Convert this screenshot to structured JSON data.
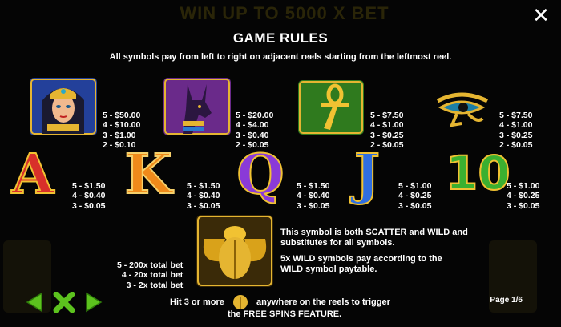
{
  "background": {
    "banner": "WIN UP TO 5000 X BET"
  },
  "header": {
    "title": "GAME RULES",
    "subtitle": "All symbols pay from left to right on adjacent reels starting from the leftmost reel."
  },
  "symbols_row1": [
    {
      "icon": "cleopatra-icon",
      "pays": [
        "5 - $50.00",
        "4 - $10.00",
        "3 - $1.00",
        "2 - $0.10"
      ]
    },
    {
      "icon": "anubis-icon",
      "pays": [
        "5 - $20.00",
        "4 - $4.00",
        "3 - $0.40",
        "2 - $0.05"
      ]
    },
    {
      "icon": "ankh-icon",
      "pays": [
        "5 - $7.50",
        "4 - $1.00",
        "3 - $0.25",
        "2 - $0.05"
      ]
    },
    {
      "icon": "eye-of-horus-icon",
      "pays": [
        "5 - $7.50",
        "4 - $1.00",
        "3 - $0.25",
        "2 - $0.05"
      ]
    }
  ],
  "symbols_row2": [
    {
      "letter": "A",
      "icon": "letter-a-icon",
      "color": "#d8302a",
      "pays": [
        "5 - $1.50",
        "4 - $0.40",
        "3 - $0.05"
      ]
    },
    {
      "letter": "K",
      "icon": "letter-k-icon",
      "color": "#f08a1a",
      "pays": [
        "5 - $1.50",
        "4 - $0.40",
        "3 - $0.05"
      ]
    },
    {
      "letter": "Q",
      "icon": "letter-q-icon",
      "color": "#8a3ad8",
      "pays": [
        "5 - $1.50",
        "4 - $0.40",
        "3 - $0.05"
      ]
    },
    {
      "letter": "J",
      "icon": "letter-j-icon",
      "color": "#2f6ee0",
      "pays": [
        "5 - $1.00",
        "4 - $0.25",
        "3 - $0.05"
      ]
    },
    {
      "letter": "10",
      "icon": "letter-10-icon",
      "color": "#3bb030",
      "pays": [
        "5 - $1.00",
        "4 - $0.25",
        "3 - $0.05"
      ]
    }
  ],
  "scatter": {
    "icon": "scarab-icon",
    "pays": [
      "5 - 200x total bet",
      "4 - 20x total bet",
      "3 - 2x total bet"
    ],
    "desc1": [
      "This symbol is both SCATTER and WILD and",
      "substitutes for all symbols."
    ],
    "desc2": [
      "5x WILD symbols pay according to the",
      "WILD symbol paytable."
    ]
  },
  "footer": {
    "line1_before": "Hit 3 or more",
    "line1_after": "anywhere on the reels to trigger",
    "line2": "the FREE SPINS FEATURE.",
    "page": "Page 1/6"
  },
  "colors": {
    "gold": "#e8b21a",
    "nav_green": "#5cc21e"
  }
}
